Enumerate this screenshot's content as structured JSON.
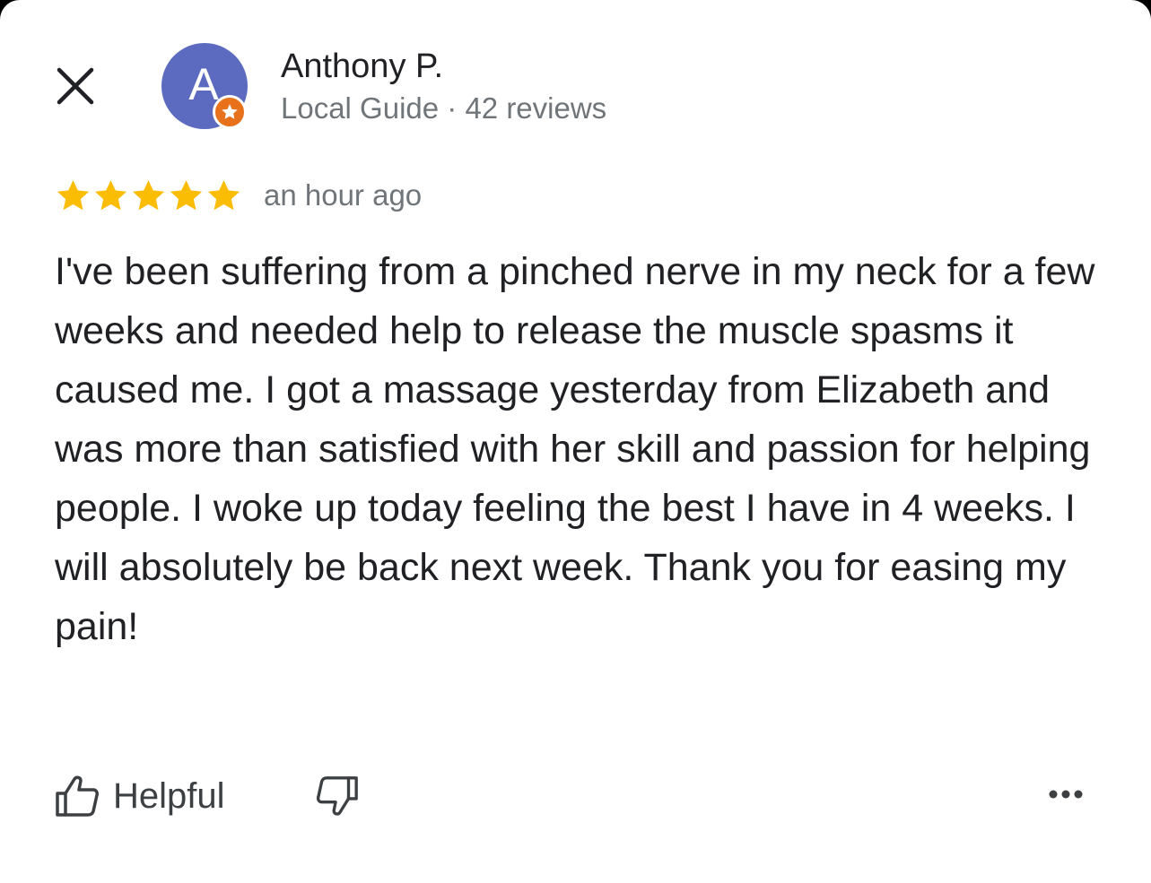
{
  "colors": {
    "avatar_bg": "#5c6bc0",
    "badge_bg": "#e8711c",
    "star_fill": "#fbbc04",
    "text_primary": "#202124",
    "text_secondary": "#70757a"
  },
  "header": {
    "close_icon": "close-icon"
  },
  "reviewer": {
    "avatar_initial": "A",
    "badge_icon": "star-badge-icon",
    "name": "Anthony P.",
    "meta": "Local Guide · 42 reviews"
  },
  "review": {
    "rating": 5,
    "rating_max": 5,
    "time": "an hour ago",
    "text": "I've been suffering from a pinched nerve in my neck for a few weeks and needed help to release the muscle spasms it caused me. I got a massage yesterday from Elizabeth and was more than satisfied with her skill and passion for helping people. I woke up today feeling the best I have in 4 weeks. I will absolutely be back next week. Thank you for easing my pain!"
  },
  "actions": {
    "helpful_label": "Helpful",
    "helpful_icon": "thumbs-up-icon",
    "dislike_icon": "thumbs-down-icon",
    "more_icon": "more-horizontal-icon"
  }
}
